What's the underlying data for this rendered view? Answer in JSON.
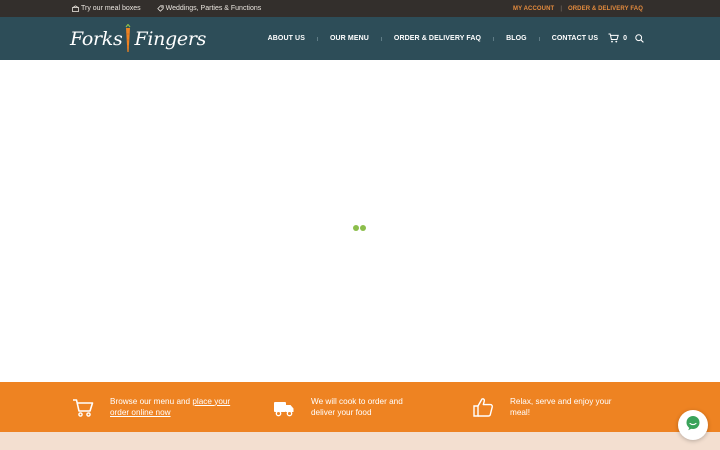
{
  "colors": {
    "topbar_bg": "#332f2c",
    "nav_bg": "#2d4d58",
    "accent_orange": "#ee8322",
    "loader_green": "#8cbe4b",
    "footer_bg": "#f3dfd0",
    "chat_green": "#3aa35a"
  },
  "topbar": {
    "promos": [
      {
        "icon": "meal-box-icon",
        "label": "Try our meal boxes"
      },
      {
        "icon": "tag-icon",
        "label": "Weddings, Parties & Functions"
      }
    ],
    "links": [
      {
        "label": "MY ACCOUNT"
      },
      {
        "label": "ORDER & DELIVERY FAQ"
      }
    ]
  },
  "header": {
    "logo": {
      "word1": "Forks",
      "word2": "Fingers"
    },
    "nav": [
      {
        "label": "ABOUT US"
      },
      {
        "label": "OUR MENU"
      },
      {
        "label": "ORDER & DELIVERY FAQ"
      },
      {
        "label": "BLOG"
      },
      {
        "label": "CONTACT US"
      }
    ],
    "cart_count": "0"
  },
  "features": [
    {
      "icon": "cart-icon",
      "text": "Browse our menu and ",
      "link": "place your order online now"
    },
    {
      "icon": "truck-icon",
      "text": "We will cook to order and deliver your food",
      "link": ""
    },
    {
      "icon": "thumbs-up-icon",
      "text": "Relax, serve and enjoy your meal!",
      "link": ""
    }
  ]
}
